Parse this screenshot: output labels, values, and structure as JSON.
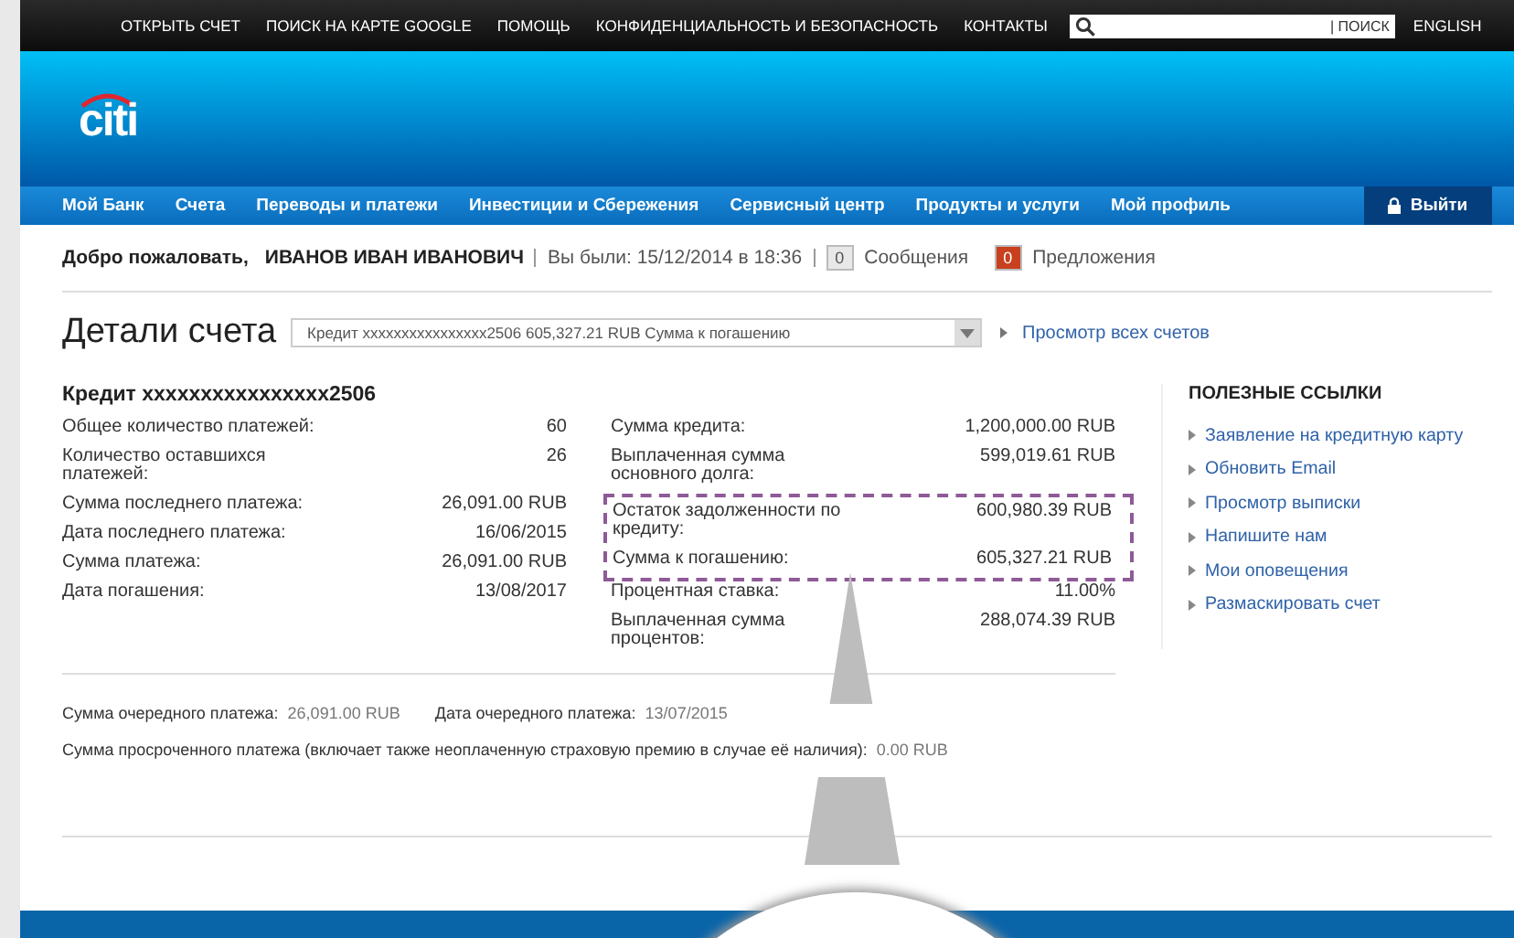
{
  "top_links": [
    "ОТКРЫТЬ СЧЕТ",
    "ПОИСК НА КАРТЕ GOOGLE",
    "ПОМОЩЬ",
    "КОНФИДЕНЦИАЛЬНОСТЬ И БЕЗОПАСНОСТЬ",
    "КОНТАКТЫ"
  ],
  "search": {
    "button": "| ПОИСК"
  },
  "language": "ENGLISH",
  "logo": "citi",
  "nav": [
    "Мой Банк",
    "Счета",
    "Переводы и платежи",
    "Инвестиции и Сбережения",
    "Сервисный центр",
    "Продукты и услуги",
    "Мой профиль"
  ],
  "logout": "Выйти",
  "welcome": {
    "greeting": "Добро пожаловать,",
    "name": "ИВАНОВ ИВАН ИВАНОВИЧ",
    "last_visit": "Вы были: 15/12/2014 в 18:36",
    "counters": [
      {
        "count": "0",
        "label": "Сообщения",
        "color": "#e8e8e8"
      },
      {
        "count": "0",
        "label": "Предложения",
        "color": "#c8401e"
      }
    ]
  },
  "page_title": "Детали счета",
  "account_select": "Кредит xxxxxxxxxxxxxxxx2506 605,327.21 RUB Сумма к погашению",
  "view_all": "Просмотр всех счетов",
  "account_name": "Кредит xxxxxxxxxxxxxxxx2506",
  "left_rows": [
    {
      "label": "Общее количество платежей:",
      "value": "60"
    },
    {
      "label": "Количество оставшихся платежей:",
      "value": "26"
    },
    {
      "label": "Сумма последнего платежа:",
      "value": "26,091.00 RUB"
    },
    {
      "label": "Дата последнего платежа:",
      "value": "16/06/2015"
    },
    {
      "label": "Сумма платежа:",
      "value": "26,091.00 RUB"
    },
    {
      "label": "Дата погашения:",
      "value": "13/08/2017"
    }
  ],
  "right_rows": [
    {
      "label": "Сумма кредита:",
      "value": "1,200,000.00 RUB",
      "highlighted": false
    },
    {
      "label": "Выплаченная сумма основного долга:",
      "value": "599,019.61 RUB",
      "highlighted": false
    },
    {
      "label": "Остаток задолженности по кредиту:",
      "value": "600,980.39 RUB",
      "highlighted": true
    },
    {
      "label": "Сумма к погашению:",
      "value": "605,327.21 RUB",
      "highlighted": true
    },
    {
      "label": "Процентная ставка:",
      "value": "11.00%",
      "highlighted": false
    },
    {
      "label": "Выплаченная сумма процентов:",
      "value": "288,074.39 RUB",
      "highlighted": false
    }
  ],
  "useful_links": {
    "title": "ПОЛЕЗНЫЕ ССЫЛКИ",
    "items": [
      "Заявление на кредитную карту",
      "Обновить Email",
      "Просмотр выписки",
      "Напишите нам",
      "Мои оповещения",
      "Размаскировать счет"
    ]
  },
  "next_payment": [
    {
      "label": "Сумма очередного платежа:",
      "value": "26,091.00 RUB"
    },
    {
      "label": "Дата очередного платежа:",
      "value": "13/07/2015"
    }
  ],
  "overdue": {
    "label": "Сумма просроченного платежа (включает также неоплаченную страховую премию в случае её наличия):",
    "value": "0.00 RUB"
  }
}
